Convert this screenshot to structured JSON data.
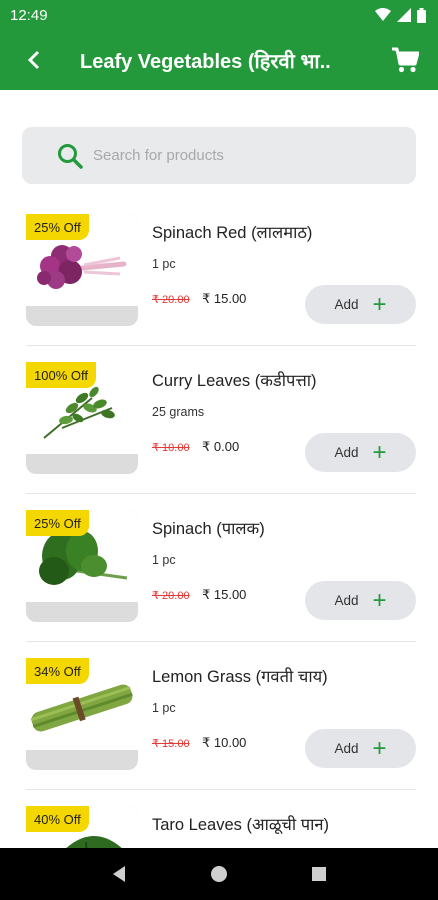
{
  "status": {
    "time": "12:49"
  },
  "toolbar": {
    "title": "Leafy Vegetables (हिरवी भा..",
    "back_icon": "chevron-left-icon",
    "cart_icon": "cart-icon"
  },
  "search": {
    "placeholder": "Search for products"
  },
  "products": [
    {
      "discount": "25% Off",
      "name": "Spinach Red (लालमाठ)",
      "qty": "1 pc",
      "old_price": "₹ 20.00",
      "price": "₹ 15.00",
      "add_label": "Add",
      "icon": "red-spinach-image"
    },
    {
      "discount": "100% Off",
      "name": "Curry Leaves (कडीपत्ता)",
      "qty": "25 grams",
      "old_price": "₹ 10.00",
      "price": "₹ 0.00",
      "add_label": "Add",
      "icon": "curry-leaves-image"
    },
    {
      "discount": "25% Off",
      "name": "Spinach (पालक)",
      "qty": "1 pc",
      "old_price": "₹ 20.00",
      "price": "₹ 15.00",
      "add_label": "Add",
      "icon": "spinach-image"
    },
    {
      "discount": "34% Off",
      "name": "Lemon Grass (गवती चाय)",
      "qty": "1 pc",
      "old_price": "₹ 15.00",
      "price": "₹ 10.00",
      "add_label": "Add",
      "icon": "lemon-grass-image"
    },
    {
      "discount": "40% Off",
      "name": "Taro Leaves (आळूची पान)",
      "qty": "",
      "old_price": "",
      "price": "",
      "add_label": "",
      "icon": "taro-leaves-image"
    }
  ],
  "colors": {
    "primary": "#24993c",
    "discount_badge": "#f5d700",
    "strike_price": "#e53935"
  }
}
